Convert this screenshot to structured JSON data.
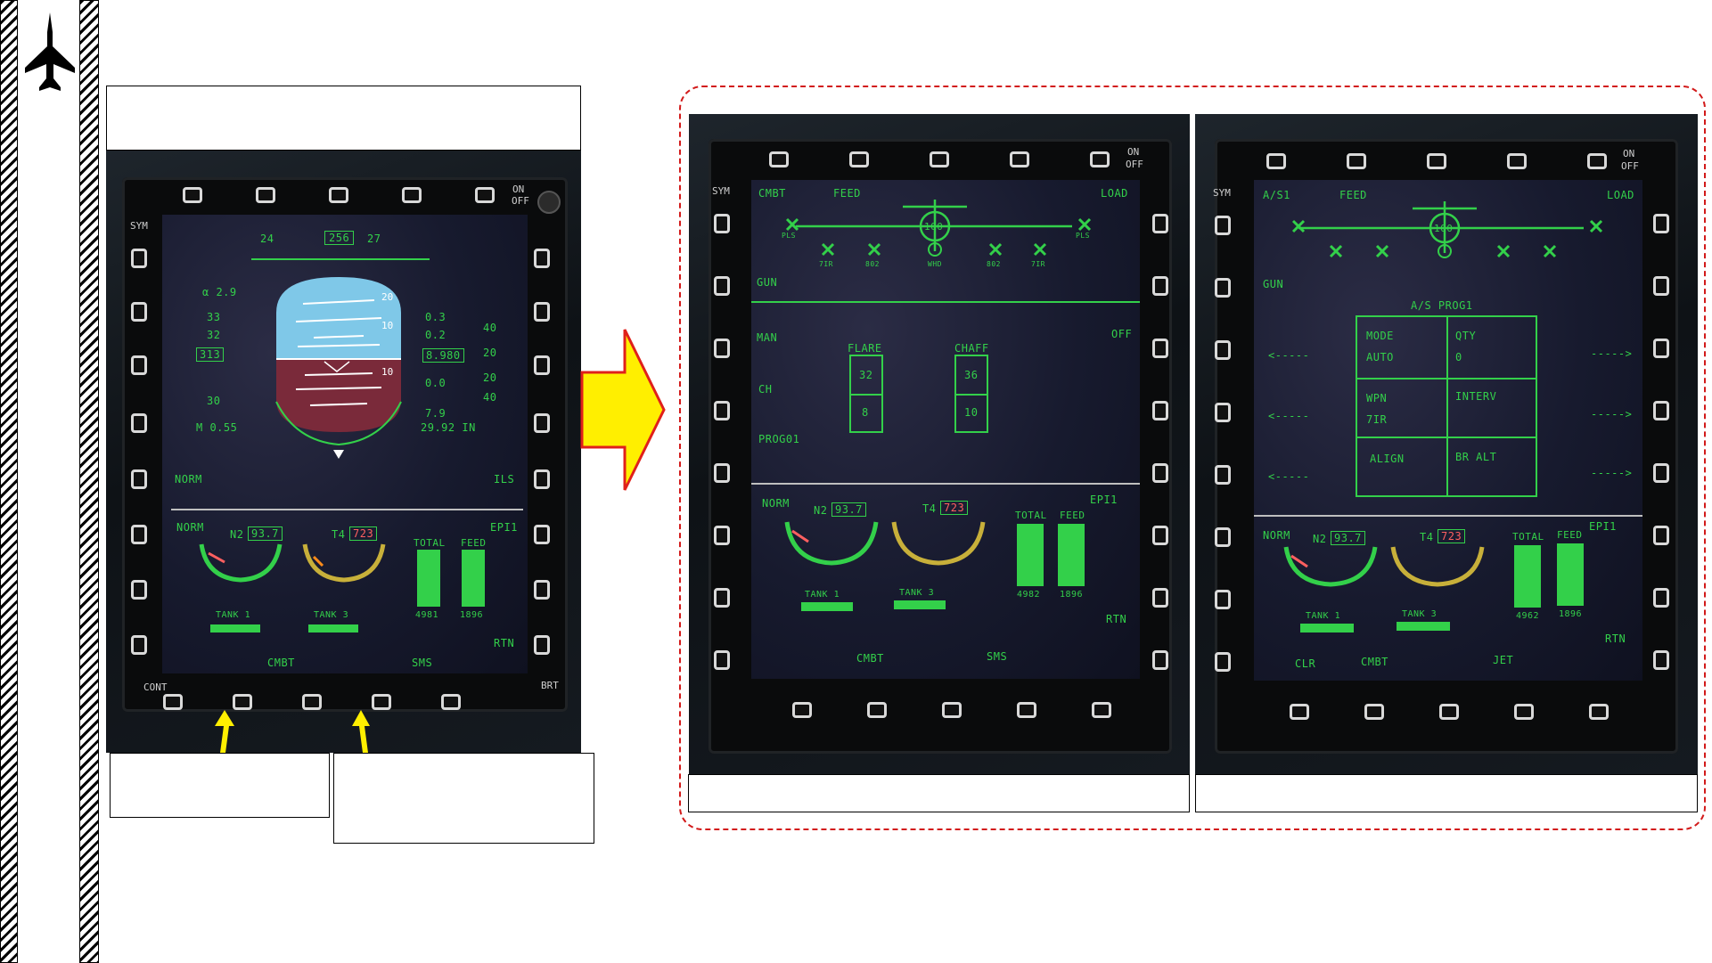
{
  "left_mfd": {
    "top_labels": {
      "on": "ON",
      "off": "OFF",
      "sym": "SYM"
    },
    "adi": {
      "heading": "256",
      "hdg_left": "24",
      "hdg_right": "27",
      "alpha": "α 2.9",
      "speed": "313",
      "speed_ticks": [
        "33",
        "32",
        "30"
      ],
      "mach": "M 0.55",
      "vvi": "8.980",
      "vvi_ticks": [
        "0.3",
        "0.2",
        "0.0",
        "7.9"
      ],
      "vs_ticks": [
        "40",
        "20",
        "20",
        "40"
      ],
      "baro": "29.92 IN",
      "pitch_up": [
        "20",
        "10"
      ],
      "pitch_down": [
        "10"
      ]
    },
    "mode_left": "NORM",
    "mode_right": "ILS",
    "engine": {
      "mode": "NORM",
      "n2_label": "N2",
      "n2": "93.7",
      "t4_label": "T4",
      "t4": "723",
      "total_label": "TOTAL",
      "feed_label": "FEED",
      "total": "4981",
      "feed": "1896",
      "tank1": "TANK 1",
      "tank3": "TANK 3",
      "epi": "EPI1",
      "rtn": "RTN"
    },
    "bottom_labels": [
      "CMBT",
      "SMS"
    ],
    "bottom_left": "CONT",
    "bottom_right": "BRT"
  },
  "sms_mfd": {
    "top_labels": [
      "CMBT",
      "FEED",
      "LOAD"
    ],
    "center": "100",
    "stations": [
      "PLS",
      "7IR",
      "802",
      "WHD",
      "802",
      "7IR",
      "PLS"
    ],
    "left_labels": [
      "GUN",
      "MAN",
      "CH",
      "PROG01"
    ],
    "right_labels": [
      "OFF"
    ],
    "flare_label": "FLARE",
    "flare_values": [
      "32",
      "8"
    ],
    "chaff_label": "CHAFF",
    "chaff_values": [
      "36",
      "10"
    ],
    "engine": {
      "total": "4982",
      "feed": "1896"
    },
    "bottom_labels": [
      "CMBT",
      "SMS"
    ]
  },
  "prog_mfd": {
    "top_labels": [
      "A/S1",
      "FEED",
      "LOAD"
    ],
    "center": "100",
    "title": "A/S PROG1",
    "grid": [
      [
        "MODE",
        "AUTO",
        "QTY",
        "0"
      ],
      [
        "WPN",
        "7IR",
        "INTERV",
        ""
      ],
      [
        "ALIGN",
        "",
        "BR ALT",
        ""
      ]
    ],
    "left_labels": [
      "GUN"
    ],
    "engine": {
      "total": "4962",
      "feed": "1896"
    },
    "bottom_labels": [
      "CLR",
      "CMBT",
      "JET"
    ]
  },
  "colors": {
    "hud_green": "#33d04a",
    "arrow_yellow": "#ffef00",
    "arrow_red": "#e0201b",
    "dash_red": "#d21a1a"
  }
}
